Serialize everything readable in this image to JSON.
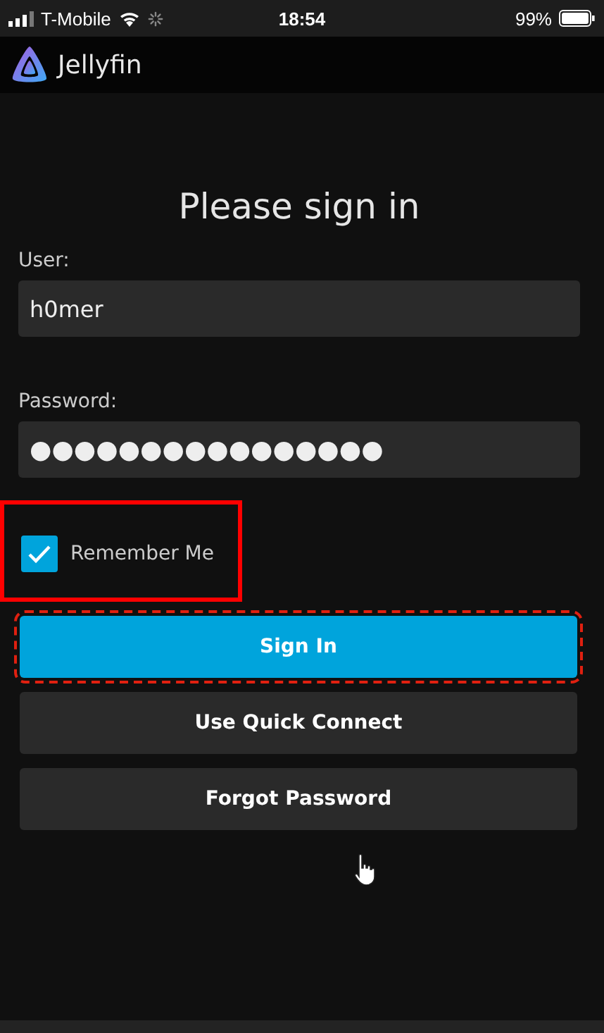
{
  "status_bar": {
    "carrier": "T-Mobile",
    "time": "18:54",
    "battery": "99%"
  },
  "header": {
    "app_name": "Jellyfin"
  },
  "title": "Please sign in",
  "fields": [
    {
      "label": "User:",
      "value": "h0mer"
    },
    {
      "label": "Password:",
      "value": "●●●●●●●●●●●●●●●●"
    }
  ],
  "remember_me": {
    "label": "Remember Me",
    "checked": true,
    "highlighted": true
  },
  "buttons": [
    {
      "label": "Sign In",
      "kind": "primary",
      "highlighted": true
    },
    {
      "label": "Use Quick Connect",
      "kind": "secondary",
      "highlighted": false
    },
    {
      "label": "Forgot Password",
      "kind": "secondary",
      "highlighted": false
    }
  ]
}
